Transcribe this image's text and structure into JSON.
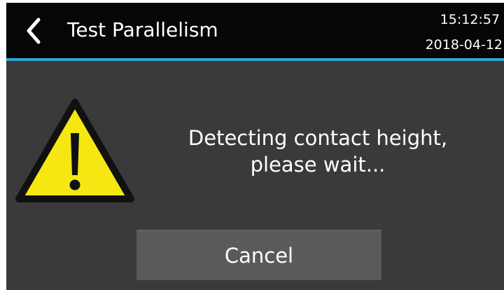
{
  "header": {
    "title": "Test Parallelism",
    "time": "15:12:57",
    "date": "2018-04-12",
    "back_icon": "chevron-left-icon",
    "accent_color": "#2fa7d6"
  },
  "dialog": {
    "icon": "warning-icon",
    "message_line1": "Detecting contact height,",
    "message_line2": "please wait...",
    "cancel_label": "Cancel"
  },
  "colors": {
    "background": "#3a3a3a",
    "header_background": "#060606",
    "warning_fill": "#f5e812",
    "button_background": "#5a5a5a"
  }
}
